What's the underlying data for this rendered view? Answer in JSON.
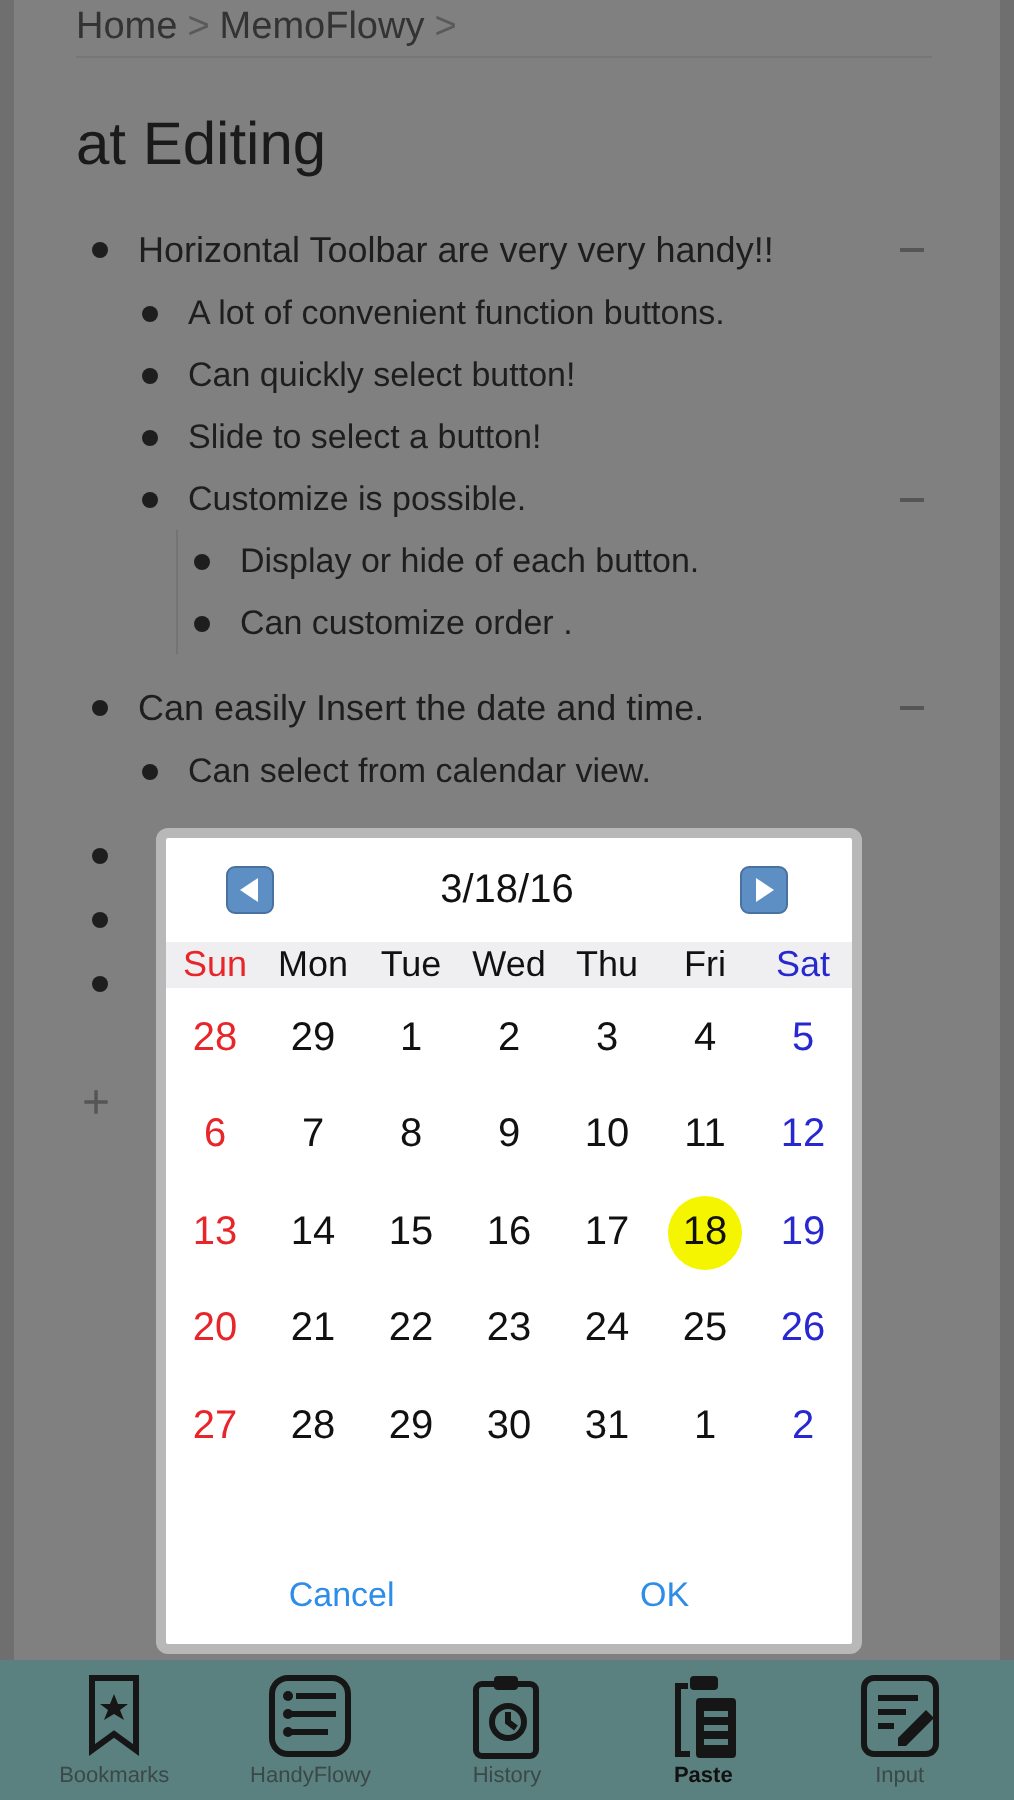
{
  "breadcrumb": [
    {
      "label": "Home"
    },
    {
      "label": "MemoFlowy"
    }
  ],
  "breadcrumb_separator": ">",
  "title": "at Editing",
  "outline": [
    {
      "kind": "item",
      "text": "Horizontal Toolbar are very very handy!!",
      "expanded": true,
      "children": [
        {
          "kind": "item",
          "text": "A lot of convenient function buttons."
        },
        {
          "kind": "item",
          "text": "Can quickly select button!"
        },
        {
          "kind": "item",
          "text": "Slide to select a button!"
        },
        {
          "kind": "item",
          "text": "Customize is possible.",
          "expanded": true,
          "children": [
            {
              "kind": "item",
              "text": "Display or hide of each button."
            },
            {
              "kind": "item",
              "text": "Can customize order ."
            }
          ]
        }
      ]
    },
    {
      "kind": "item",
      "text": "Can easily Insert the date and time.",
      "expanded": true,
      "children": [
        {
          "kind": "item",
          "text": "Can select from calendar view."
        }
      ]
    },
    {
      "kind": "covered"
    },
    {
      "kind": "covered"
    },
    {
      "kind": "covered"
    }
  ],
  "add_button": "+",
  "calendar": {
    "date": "3/18/16",
    "weekdays": [
      "Sun",
      "Mon",
      "Tue",
      "Wed",
      "Thu",
      "Fri",
      "Sat"
    ],
    "weeks": [
      [
        {
          "day": "28",
          "selected": false
        },
        {
          "day": "29",
          "selected": false
        },
        {
          "day": "1",
          "selected": false
        },
        {
          "day": "2",
          "selected": false
        },
        {
          "day": "3",
          "selected": false
        },
        {
          "day": "4",
          "selected": false
        },
        {
          "day": "5",
          "selected": false
        }
      ],
      [
        {
          "day": "6",
          "selected": false
        },
        {
          "day": "7",
          "selected": false
        },
        {
          "day": "8",
          "selected": false
        },
        {
          "day": "9",
          "selected": false
        },
        {
          "day": "10",
          "selected": false
        },
        {
          "day": "11",
          "selected": false
        },
        {
          "day": "12",
          "selected": false
        }
      ],
      [
        {
          "day": "13",
          "selected": false
        },
        {
          "day": "14",
          "selected": false
        },
        {
          "day": "15",
          "selected": false
        },
        {
          "day": "16",
          "selected": false
        },
        {
          "day": "17",
          "selected": false
        },
        {
          "day": "18",
          "selected": true
        },
        {
          "day": "19",
          "selected": false
        }
      ],
      [
        {
          "day": "20",
          "selected": false
        },
        {
          "day": "21",
          "selected": false
        },
        {
          "day": "22",
          "selected": false
        },
        {
          "day": "23",
          "selected": false
        },
        {
          "day": "24",
          "selected": false
        },
        {
          "day": "25",
          "selected": false
        },
        {
          "day": "26",
          "selected": false
        }
      ],
      [
        {
          "day": "27",
          "selected": false
        },
        {
          "day": "28",
          "selected": false
        },
        {
          "day": "29",
          "selected": false
        },
        {
          "day": "30",
          "selected": false
        },
        {
          "day": "31",
          "selected": false
        },
        {
          "day": "1",
          "selected": false
        },
        {
          "day": "2",
          "selected": false
        }
      ]
    ],
    "buttons": [
      "Cancel",
      "OK"
    ]
  },
  "toolbar": [
    {
      "kind": "bookmarks",
      "label": "Bookmarks",
      "selected": false
    },
    {
      "kind": "handyflowy",
      "label": "HandyFlowy",
      "selected": false
    },
    {
      "kind": "history",
      "label": "History",
      "selected": false
    },
    {
      "kind": "paste",
      "label": "Paste",
      "selected": true
    },
    {
      "kind": "input",
      "label": "Input",
      "selected": false
    }
  ]
}
